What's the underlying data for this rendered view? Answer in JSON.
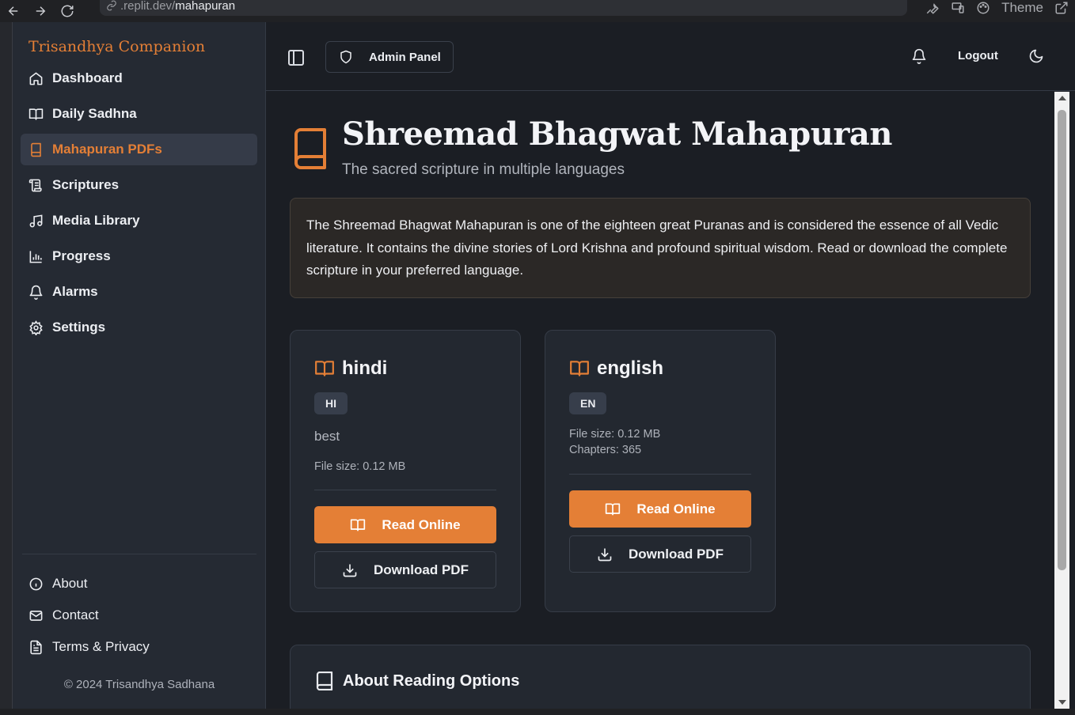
{
  "browser": {
    "url_prefix": ".replit.dev/",
    "url_path": "mahapuran",
    "theme_label": "Theme"
  },
  "sidebar": {
    "brand": "Trisandhya Companion",
    "items": [
      {
        "label": "Dashboard",
        "icon": "home-icon",
        "active": false
      },
      {
        "label": "Daily Sadhna",
        "icon": "book-open-icon",
        "active": false
      },
      {
        "label": "Mahapuran PDFs",
        "icon": "book-icon",
        "active": true
      },
      {
        "label": "Scriptures",
        "icon": "scroll-icon",
        "active": false
      },
      {
        "label": "Media Library",
        "icon": "music-icon",
        "active": false
      },
      {
        "label": "Progress",
        "icon": "bar-chart-icon",
        "active": false
      },
      {
        "label": "Alarms",
        "icon": "bell-icon",
        "active": false
      },
      {
        "label": "Settings",
        "icon": "gear-icon",
        "active": false
      }
    ],
    "footer_items": [
      {
        "label": "About",
        "icon": "info-icon"
      },
      {
        "label": "Contact",
        "icon": "mail-icon"
      },
      {
        "label": "Terms & Privacy",
        "icon": "file-text-icon"
      }
    ],
    "copyright": "© 2024 Trisandhya Sadhana"
  },
  "topbar": {
    "admin_label": "Admin Panel",
    "logout_label": "Logout"
  },
  "page": {
    "title": "Shreemad Bhagwat Mahapuran",
    "subtitle": "The sacred scripture in multiple languages",
    "intro": "The Shreemad Bhagwat Mahapuran is one of the eighteen great Puranas and is considered the essence of all Vedic literature. It contains the divine stories of Lord Krishna and profound spiritual wisdom. Read or download the complete scripture in your preferred language."
  },
  "cards": [
    {
      "language": "hindi",
      "code": "HI",
      "description": "best",
      "file_size": "File size: 0.12 MB",
      "chapters": "",
      "read_label": "Read Online",
      "download_label": "Download PDF"
    },
    {
      "language": "english",
      "code": "EN",
      "description": "",
      "file_size": "File size: 0.12 MB",
      "chapters": "Chapters: 365",
      "read_label": "Read Online",
      "download_label": "Download PDF"
    }
  ],
  "about_section": {
    "title": "About Reading Options"
  },
  "colors": {
    "accent": "#e47f36",
    "background": "#1b1e24",
    "sidebar": "#252a33",
    "card": "#232830"
  }
}
